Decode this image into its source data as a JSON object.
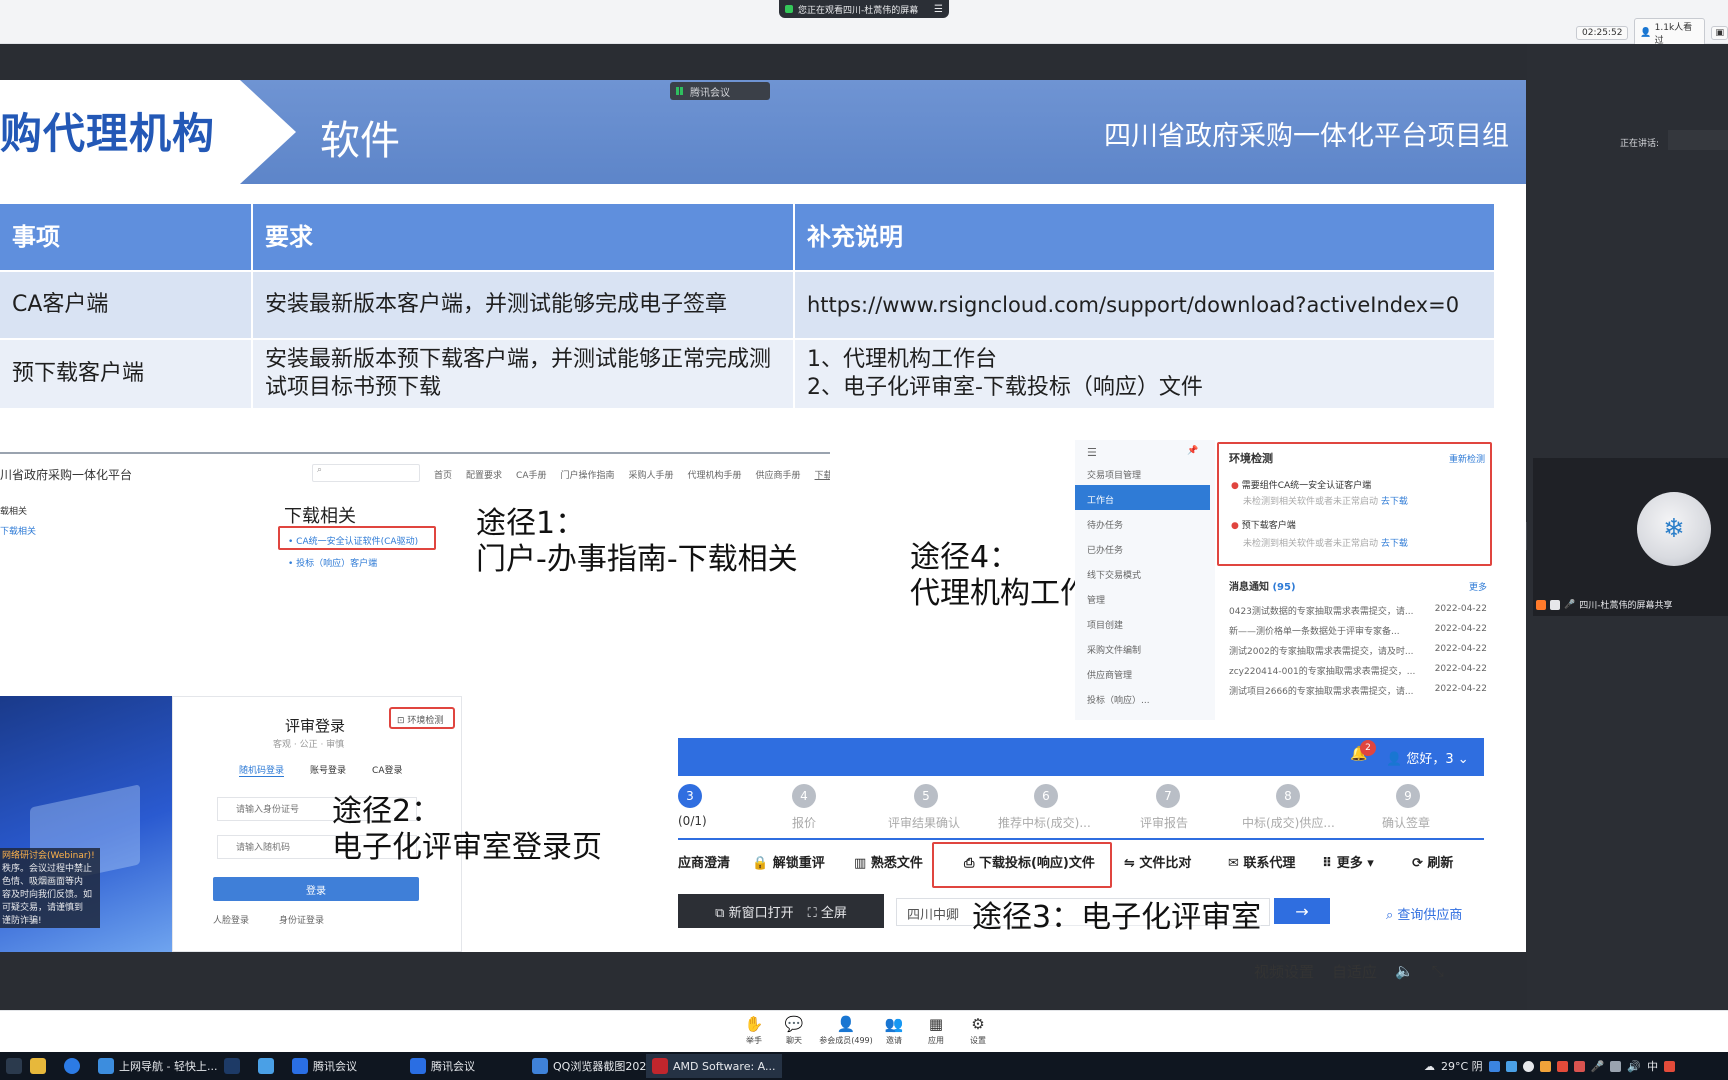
{
  "top_bar": {
    "sharing_text": "您正在观看四川-杜蒿伟的屏幕",
    "time": "02:25:52",
    "viewers": "1.1k人看过"
  },
  "side_panel": {
    "speaking_label": "正在讲话:",
    "tile_name": "四川-杜蒿伟的屏幕共享"
  },
  "slide": {
    "meeting_badge": "腾讯会议",
    "banner_title": "购代理机构",
    "banner_sub": "软件",
    "banner_right": "四川省政府采购一体化平台项目组",
    "table": {
      "headers": [
        "事项",
        "要求",
        "补充说明"
      ],
      "rows": [
        {
          "item": "CA客户端",
          "req": "安装最新版本客户端，并测试能够完成电子签章",
          "note1": "https://www.rsigncloud.com/support/download?activeIndex=0",
          "note2": ""
        },
        {
          "item": "预下载客户端",
          "req": "安装最新版本预下载客户端，并测试能够正常完成测试项目标书预下载",
          "note1": "1、代理机构工作台",
          "note2": "2、电子化评审室-下载投标（响应）文件"
        }
      ]
    },
    "route1": {
      "portal_name": "川省政府采购一体化平台",
      "nav": [
        "首页",
        "配置要求",
        "CA手册",
        "门户操作指南",
        "采购人手册",
        "代理机构手册",
        "供应商手册",
        "下载相关"
      ],
      "side_items": [
        "载相关",
        "下载相关"
      ],
      "section_title": "下载相关",
      "link1": "CA统一安全认证软件(CA驱动)",
      "link2": "投标（响应）客户端",
      "label_line1": "途径1：",
      "label_line2": "门户-办事指南-下载相关"
    },
    "route4": {
      "label_line1": "途径4：",
      "label_line2": "代理机构工作台",
      "menu": [
        "交易项目管理",
        "工作台",
        "待办任务",
        "已办任务",
        "线下交易模式",
        "管理",
        "项目创建",
        "采购文件编制",
        "供应商管理",
        "投标（响应）..."
      ],
      "env_title": "环境检测",
      "env_link": "重新检测",
      "env_item1": "需要组件CA统一安全认证客户端",
      "env_item1_sub": "未检测到相关软件或者未正常启动",
      "env_item2": "预下载客户端",
      "env_item2_sub": "未检测到相关软件或者未正常启动",
      "env_go": "去下载",
      "notice_title": "消息通知",
      "notice_count": "(95)",
      "notice_more": "更多",
      "notices": [
        {
          "text": "0423测试数据的专家抽取需求表需提交，请...",
          "date": "2022-04-22"
        },
        {
          "text": "新——测价格单一条数据处于评审专家备...",
          "date": "2022-04-22"
        },
        {
          "text": "测试2002的专家抽取需求表需提交，请及时...",
          "date": "2022-04-22"
        },
        {
          "text": "zcy220414-001的专家抽取需求表需提交，...",
          "date": "2022-04-22"
        },
        {
          "text": "测试项目2666的专家抽取需求表需提交，请...",
          "date": "2022-04-22"
        }
      ]
    },
    "route2": {
      "login_title": "评审登录",
      "login_sub": "客观 · 公正 · 审慎",
      "env_btn": "环境检测",
      "tabs": [
        "随机码登录",
        "账号登录",
        "CA登录"
      ],
      "placeholder1": "请输入身份证号",
      "placeholder2": "请输入随机码",
      "login_btn": "登录",
      "opt1": "人脸登录",
      "opt2": "身份证登录",
      "label_line1": "途径2：",
      "label_line2": "电子化评审室登录页",
      "notice_lines": [
        "网络研讨会(Webinar)!",
        "秩序。会议过程中禁止",
        "色情、吸烟画面等内",
        "容及时向我们反馈。如",
        "可疑交易，请谨慎到",
        "谨防诈骗!"
      ]
    },
    "route3": {
      "badge": "2",
      "greeting": "您好，3",
      "steps": [
        {
          "num": "3",
          "label": "(0/1)"
        },
        {
          "num": "4",
          "label": "报价"
        },
        {
          "num": "5",
          "label": "评审结果确认"
        },
        {
          "num": "6",
          "label": "推荐中标(成交)..."
        },
        {
          "num": "7",
          "label": "评审报告"
        },
        {
          "num": "8",
          "label": "中标(成交)供应..."
        },
        {
          "num": "9",
          "label": "确认签章"
        }
      ],
      "actions": [
        "应商澄清",
        "解锁重评",
        "熟悉文件",
        "下载投标(响应)文件",
        "文件比对",
        "联系代理",
        "更多",
        "刷新"
      ],
      "new_window": "新窗口打开",
      "fullscreen": "全屏",
      "search_value": "四川中卿",
      "search_link": "查询供应商",
      "label": "途径3：电子化评审室"
    },
    "controls": [
      "视频设置",
      "自适应"
    ]
  },
  "toolbar": [
    {
      "icon": "hand-icon",
      "label": "举手"
    },
    {
      "icon": "chat-icon",
      "label": "聊天"
    },
    {
      "icon": "members-icon",
      "label": "参会成员(499)"
    },
    {
      "icon": "invite-icon",
      "label": "邀请"
    },
    {
      "icon": "apps-icon",
      "label": "应用"
    },
    {
      "icon": "settings-icon",
      "label": "设置"
    }
  ],
  "taskbar": {
    "items": [
      "上网导航 - 轻快上...",
      "腾讯会议",
      "腾讯会议",
      "QQ浏览器截图202...",
      "AMD Software: A..."
    ],
    "weather": "29°C 阴",
    "ime": "中"
  }
}
